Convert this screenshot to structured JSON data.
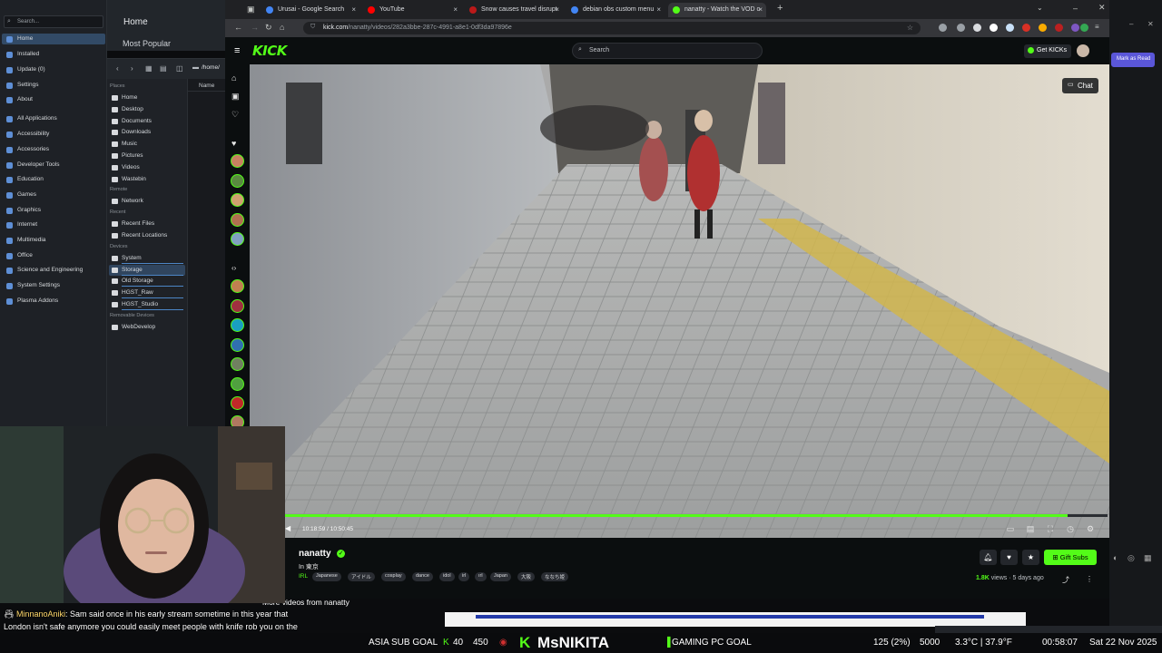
{
  "launcher": {
    "search_placeholder": "Search...",
    "items": [
      {
        "label": "Home",
        "selected": true
      },
      {
        "label": "Installed"
      },
      {
        "label": "Update (0)"
      },
      {
        "label": "Settings"
      },
      {
        "label": "About"
      },
      {
        "label": "All Applications"
      },
      {
        "label": "Accessibility"
      },
      {
        "label": "Accessories"
      },
      {
        "label": "Developer Tools"
      },
      {
        "label": "Education"
      },
      {
        "label": "Games"
      },
      {
        "label": "Graphics"
      },
      {
        "label": "Internet"
      },
      {
        "label": "Multimedia"
      },
      {
        "label": "Office"
      },
      {
        "label": "Science and Engineering"
      },
      {
        "label": "System Settings"
      },
      {
        "label": "Plasma Addons"
      }
    ]
  },
  "home_panel": {
    "title": "Home",
    "subtitle": "Most Popular"
  },
  "file_manager": {
    "path": "/home/",
    "column_header": "Name",
    "sections": {
      "places": "Places",
      "remote": "Remote",
      "recent": "Recent",
      "devices": "Devices",
      "removable": "Removable Devices"
    },
    "places": [
      "Home",
      "Desktop",
      "Documents",
      "Downloads",
      "Music",
      "Pictures",
      "Videos",
      "Wastebin"
    ],
    "remote": [
      "Network"
    ],
    "recent": [
      "Recent Files",
      "Recent Locations"
    ],
    "devices": [
      "System",
      "Storage",
      "Old Storage",
      "HGST_Raw",
      "HGST_Studio"
    ],
    "removable": [
      "WebDevelop"
    ]
  },
  "browser": {
    "tabs": [
      {
        "title": "Urusai - Google Search",
        "color": "#4285f4"
      },
      {
        "title": "YouTube",
        "color": "#ff0000"
      },
      {
        "title": "Snow causes travel disrupt",
        "color": "#bb1919"
      },
      {
        "title": "debian obs custom menu",
        "color": "#4285f4"
      },
      {
        "title": "nanatty - Watch the VOD o",
        "color": "#53fc18",
        "active": true
      }
    ],
    "new_tab": "+",
    "url_domain": "kick.com",
    "url_path": "/nanatty/videos/282a3bbe-287c-4991-a8e1-0df3da97896e"
  },
  "kick": {
    "logo": "KICK",
    "search_placeholder": "Search",
    "get_kicks": "Get KICKs",
    "chat_button": "Chat",
    "player": {
      "current_time": "10:18:59",
      "duration": "10:50:45",
      "time_display": "10:18:59 / 10:50:45",
      "progress": 0.951
    },
    "channel": {
      "name": "nanatty",
      "title": "In 東京",
      "category": "IRL",
      "tags": [
        "Japanese",
        "アイドル",
        "cosplay",
        "dance",
        "idol",
        "irl",
        "ırl",
        "Japan",
        "大阪",
        "ななち姫"
      ],
      "views": "1.8K",
      "views_suffix": " views",
      "age": "5 days ago",
      "gift_subs": "Gift Subs"
    },
    "more_videos": "More videos from nanatty"
  },
  "right_strip": {
    "read_button": "Mark as Read"
  },
  "stream_overlay": {
    "chat_user": "MinnanoAniki",
    "chat_message": ": Sam said once in his early stream sometime in this year that London isn't safe anymore you could easily meet people with knife rob you on the street, is this true?",
    "sub_goal_label": "ASIA SUB GOAL",
    "sub_goal_current": "40",
    "sub_goal_target": "450",
    "streamer_brand": "MsNIKITA",
    "pc_goal_label": "GAMING PC GOAL",
    "pc_goal_progress": "125 (2%)",
    "pc_goal_target": "5000",
    "temperature": "3.3°C | 37.9°F",
    "clock": "00:58:07",
    "date": "Sat 22 Nov 2025"
  }
}
